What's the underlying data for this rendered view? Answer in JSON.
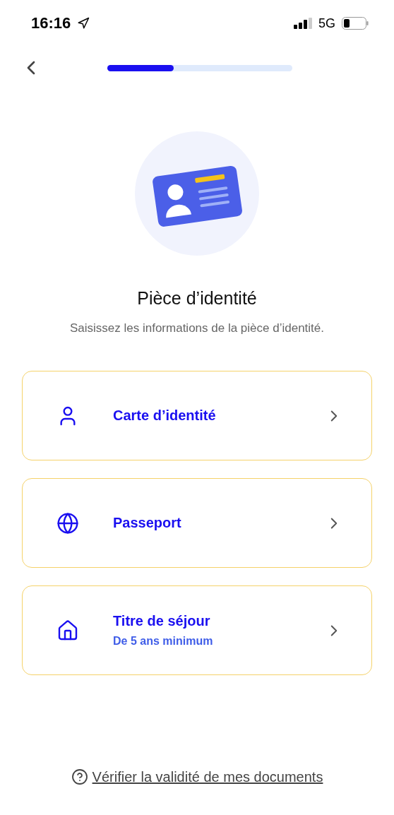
{
  "status_bar": {
    "time": "16:16",
    "network": "5G"
  },
  "progress": {
    "level": 0.36
  },
  "title": "Pièce d’identité",
  "subtitle": "Saisissez les informations de la pièce d’identité.",
  "options": [
    {
      "kind": "person",
      "label": "Carte d’identité"
    },
    {
      "kind": "globe",
      "label": "Passeport"
    },
    {
      "kind": "house",
      "label": "Titre de séjour",
      "note": "De 5 ans minimum"
    }
  ],
  "help_link": "Vérifier la validité de mes documents"
}
